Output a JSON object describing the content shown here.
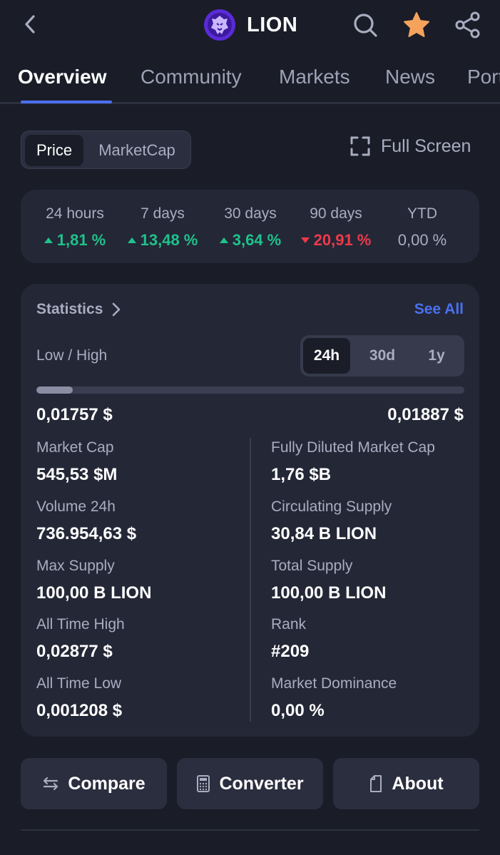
{
  "header": {
    "coin_name": "LION",
    "icons": [
      "back-icon",
      "search-icon",
      "star-icon",
      "share-icon"
    ],
    "star_color": "#f5a35c",
    "logo_color": "#5a2bd6"
  },
  "tabs": [
    {
      "label": "Overview",
      "active": true
    },
    {
      "label": "Community",
      "active": false
    },
    {
      "label": "Markets",
      "active": false
    },
    {
      "label": "News",
      "active": false
    },
    {
      "label": "Portfolio",
      "active": false
    }
  ],
  "chart_mode": {
    "options": [
      "Price",
      "MarketCap"
    ],
    "selected": "Price",
    "full_screen_label": "Full Screen"
  },
  "changes": [
    {
      "label": "24 hours",
      "value": "1,81 %",
      "direction": "up"
    },
    {
      "label": "7 days",
      "value": "13,48 %",
      "direction": "up"
    },
    {
      "label": "30 days",
      "value": "3,64 %",
      "direction": "up"
    },
    {
      "label": "90 days",
      "value": "20,91 %",
      "direction": "down"
    },
    {
      "label": "YTD",
      "value": "0,00 %",
      "direction": "flat"
    }
  ],
  "colors": {
    "up": "#1ec28b",
    "down": "#ee3a4a",
    "accent": "#4a70f0"
  },
  "statistics": {
    "title": "Statistics",
    "see_all": "See All",
    "low_high_label": "Low / High",
    "ranges": [
      "24h",
      "30d",
      "1y"
    ],
    "selected_range": "24h",
    "low": "0,01757 $",
    "high": "0,01887 $",
    "range_fill_fraction": 0.085,
    "left": [
      {
        "key": "Market Cap",
        "value": "545,53 $M"
      },
      {
        "key": "Volume 24h",
        "value": "736.954,63 $"
      },
      {
        "key": "Max Supply",
        "value": "100,00 B LION"
      },
      {
        "key": "All Time High",
        "value": "0,02877 $"
      },
      {
        "key": "All Time Low",
        "value": "0,001208 $"
      }
    ],
    "right": [
      {
        "key": "Fully Diluted Market Cap",
        "value": "1,76 $B"
      },
      {
        "key": "Circulating Supply",
        "value": "30,84 B LION"
      },
      {
        "key": "Total Supply",
        "value": "100,00 B LION"
      },
      {
        "key": "Rank",
        "value": "#209"
      },
      {
        "key": "Market Dominance",
        "value": "0,00 %"
      }
    ]
  },
  "actions": [
    {
      "label": "Compare",
      "icon": "swap-arrows-icon"
    },
    {
      "label": "Converter",
      "icon": "calculator-icon"
    },
    {
      "label": "About",
      "icon": "document-icon"
    }
  ]
}
